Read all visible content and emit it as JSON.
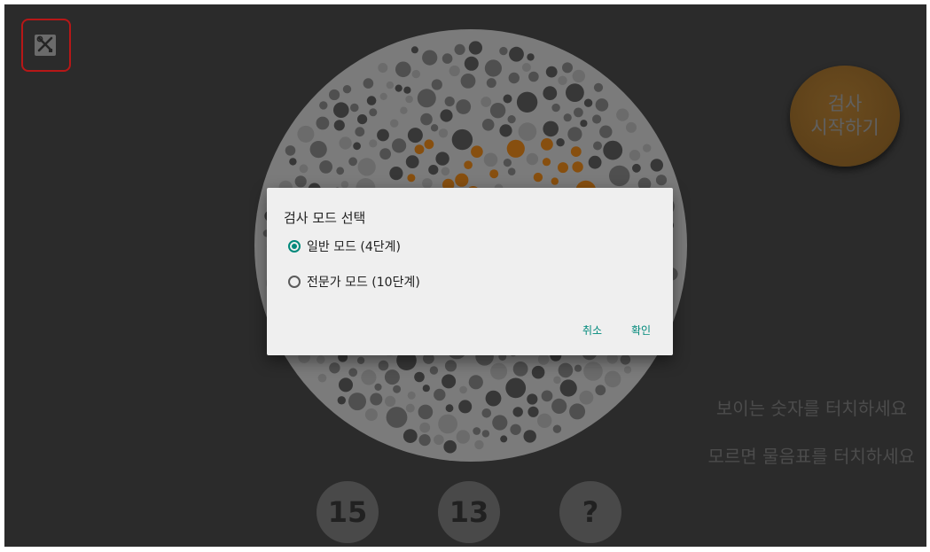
{
  "toolbar": {
    "tools_icon": "tools-icon"
  },
  "start_button": {
    "line1": "검사",
    "line2": "시작하기",
    "color": "#6a4a1d"
  },
  "instructions": {
    "line1": "보이는 숫자를 터치하세요",
    "line2": "모르면 물음표를 터치하세요"
  },
  "answers": [
    "15",
    "13",
    "?"
  ],
  "dialog": {
    "title": "검사 모드 선택",
    "options": [
      {
        "label": "일반 모드 (4단계)",
        "selected": true
      },
      {
        "label": "전문가 모드 (10단계)",
        "selected": false
      }
    ],
    "cancel_label": "취소",
    "ok_label": "확인",
    "accent": "#00897b"
  },
  "highlight_color": "#d11b1b",
  "plate_colors": {
    "background": "#8d8d8d",
    "dots_dark": "#3f3f3f",
    "dots_mid": "#5b5b5b",
    "dots_light": "#7a7a7a",
    "dots_orange": "#9a5a12"
  }
}
